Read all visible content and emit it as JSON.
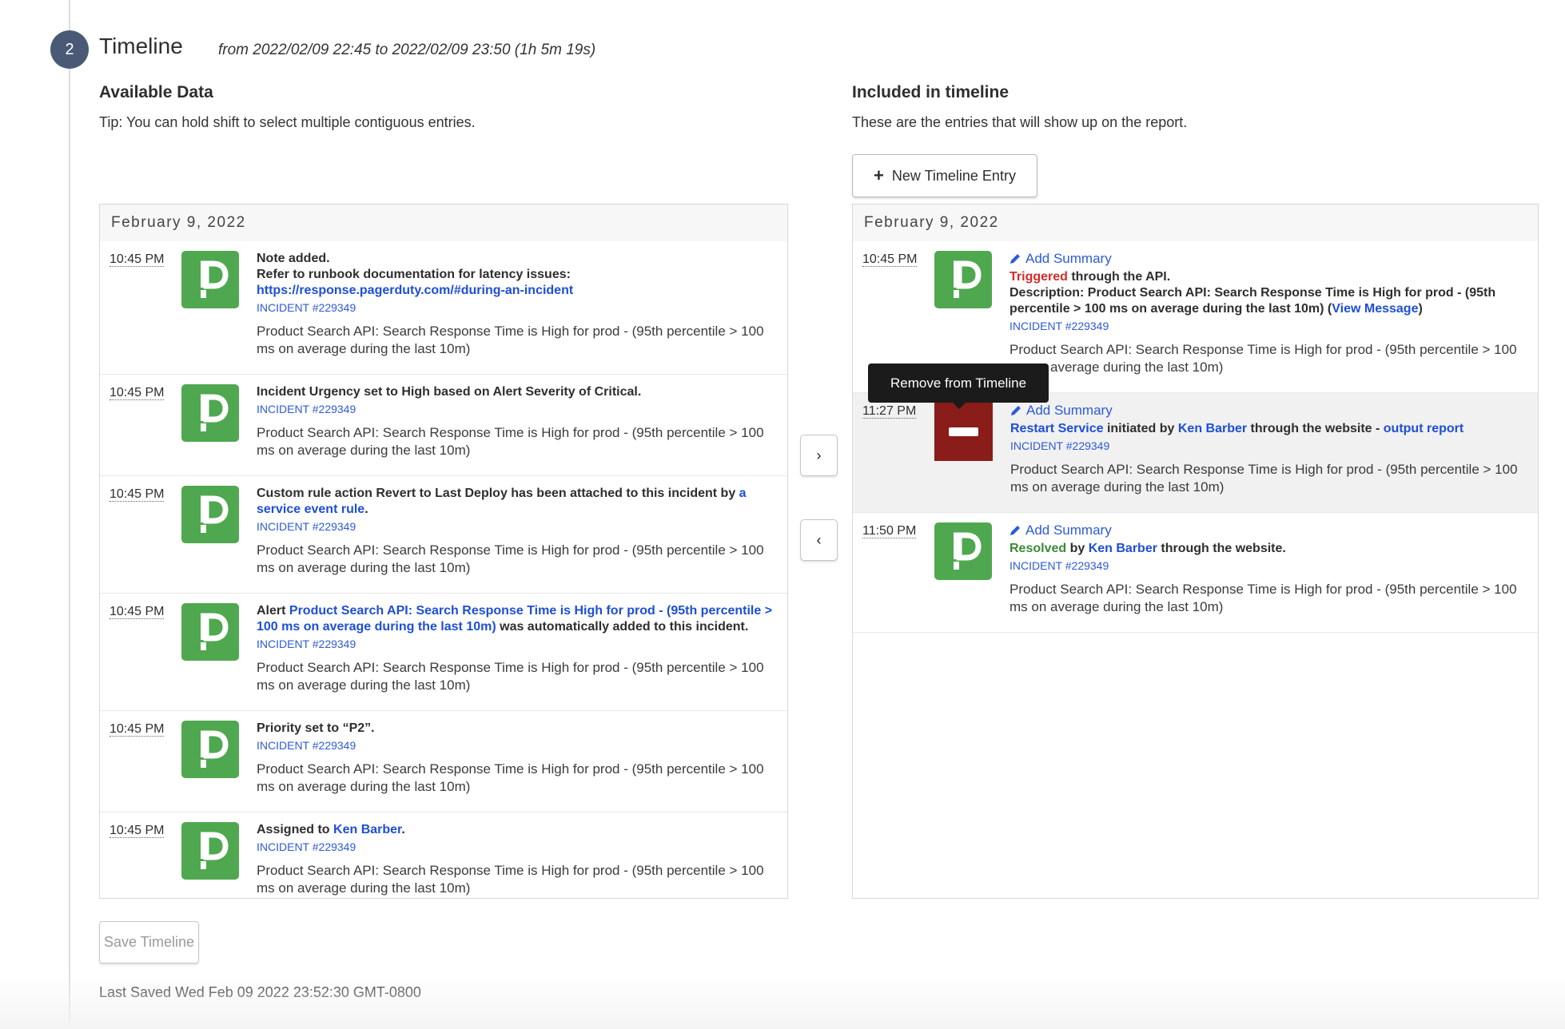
{
  "step": {
    "number": "2",
    "title": "Timeline",
    "range": "from 2022/02/09 22:45 to 2022/02/09 23:50 (1h 5m 19s)"
  },
  "available": {
    "heading": "Available Data",
    "tip": "Tip: You can hold shift to select multiple contiguous entries.",
    "date": "February 9, 2022",
    "entries": [
      {
        "time": "10:45 PM",
        "title_parts": [
          {
            "text": "Note added.",
            "type": "bold"
          },
          {
            "text": "Refer to runbook documentation for latency issues:",
            "type": "bold",
            "newline": true
          },
          {
            "text": "https://response.pagerduty.com/#during-an-incident",
            "type": "link",
            "newline": true
          }
        ],
        "incident": "INCIDENT #229349",
        "description": "Product Search API: Search Response Time is High for prod - (95th percentile > 100 ms on average during the last 10m)"
      },
      {
        "time": "10:45 PM",
        "title_parts": [
          {
            "text": "Incident Urgency set to High based on Alert Severity of Critical.",
            "type": "bold"
          }
        ],
        "incident": "INCIDENT #229349",
        "description": "Product Search API: Search Response Time is High for prod - (95th percentile > 100 ms on average during the last 10m)"
      },
      {
        "time": "10:45 PM",
        "title_parts": [
          {
            "text": "Custom rule action Revert to Last Deploy has been attached to this incident by ",
            "type": "bold"
          },
          {
            "text": "a service event rule",
            "type": "link"
          },
          {
            "text": ".",
            "type": "bold"
          }
        ],
        "incident": "INCIDENT #229349",
        "description": "Product Search API: Search Response Time is High for prod - (95th percentile > 100 ms on average during the last 10m)"
      },
      {
        "time": "10:45 PM",
        "title_parts": [
          {
            "text": "Alert ",
            "type": "bold"
          },
          {
            "text": "Product Search API: Search Response Time is High for prod - (95th percentile > 100 ms on average during the last 10m)",
            "type": "link"
          },
          {
            "text": " was automatically added to this incident.",
            "type": "bold"
          }
        ],
        "incident": "INCIDENT #229349",
        "description": "Product Search API: Search Response Time is High for prod - (95th percentile > 100 ms on average during the last 10m)"
      },
      {
        "time": "10:45 PM",
        "title_parts": [
          {
            "text": "Priority set to “P2”.",
            "type": "bold"
          }
        ],
        "incident": "INCIDENT #229349",
        "description": "Product Search API: Search Response Time is High for prod - (95th percentile > 100 ms on average during the last 10m)"
      },
      {
        "time": "10:45 PM",
        "title_parts": [
          {
            "text": "Assigned to ",
            "type": "bold"
          },
          {
            "text": "Ken Barber",
            "type": "link"
          },
          {
            "text": ".",
            "type": "bold"
          }
        ],
        "incident": "INCIDENT #229349",
        "description": "Product Search API: Search Response Time is High for prod - (95th percentile > 100 ms on average during the last 10m)"
      }
    ]
  },
  "included": {
    "heading": "Included in timeline",
    "tip": "These are the entries that will show up on the report.",
    "new_entry_label": "New Timeline Entry",
    "date": "February 9, 2022",
    "add_summary_label": "Add Summary",
    "entries": [
      {
        "time": "10:45 PM",
        "title_parts": [
          {
            "text": "Triggered",
            "type": "triggered"
          },
          {
            "text": " through the API.",
            "type": "bold"
          },
          {
            "text": "Description: Product Search API: Search Response Time is High for prod - (95th percentile > 100 ms on average during the last 10m) (",
            "type": "bold",
            "newline": true
          },
          {
            "text": "View Message",
            "type": "link"
          },
          {
            "text": ")",
            "type": "bold"
          }
        ],
        "incident": "INCIDENT #229349",
        "description": "Product Search API: Search Response Time is High for prod - (95th percentile > 100 ms on average during the last 10m)"
      },
      {
        "time": "11:27 PM",
        "selected": true,
        "title_parts": [
          {
            "text": "Restart Service",
            "type": "link"
          },
          {
            "text": " initiated by ",
            "type": "bold"
          },
          {
            "text": "Ken Barber",
            "type": "link"
          },
          {
            "text": " through the website - ",
            "type": "bold"
          },
          {
            "text": "output report",
            "type": "link"
          }
        ],
        "incident": "INCIDENT #229349",
        "description": "Product Search API: Search Response Time is High for prod - (95th percentile > 100 ms on average during the last 10m)"
      },
      {
        "time": "11:50 PM",
        "title_parts": [
          {
            "text": "Resolved",
            "type": "resolved"
          },
          {
            "text": " by ",
            "type": "bold"
          },
          {
            "text": "Ken Barber",
            "type": "link"
          },
          {
            "text": " through the website.",
            "type": "bold"
          }
        ],
        "incident": "INCIDENT #229349",
        "description": "Product Search API: Search Response Time is High for prod - (95th percentile > 100 ms on average during the last 10m)"
      }
    ]
  },
  "transfer": {
    "add_label": "›",
    "remove_label": "‹"
  },
  "tooltip": "Remove from Timeline",
  "footer": {
    "save_label": "Save Timeline",
    "last_saved": "Last Saved Wed Feb 09 2022 23:52:30 GMT-0800"
  },
  "colors": {
    "step_circle": "#4a5a76",
    "pd_green": "#4fa84f",
    "remove_red": "#8a1c19",
    "link_blue": "#1d4ed8",
    "triggered_red": "#d42a2a",
    "resolved_green": "#3a8a37"
  }
}
